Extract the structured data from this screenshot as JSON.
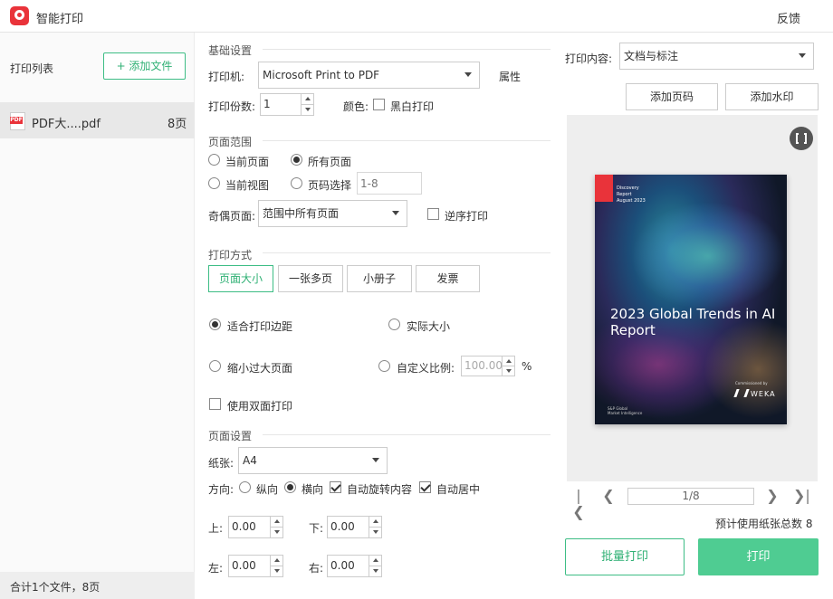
{
  "titlebar": {
    "title": "智能打印",
    "feedback": "反馈"
  },
  "sidebar": {
    "title": "打印列表",
    "add_file": "+ 添加文件",
    "files": [
      {
        "name": "PDF大....pdf",
        "pages": "8页"
      }
    ],
    "footer": "合计1个文件，8页"
  },
  "basic": {
    "section": "基础设置",
    "printer_label": "打印机:",
    "printer_value": "Microsoft Print to PDF",
    "properties": "属性",
    "copies_label": "打印份数:",
    "copies_value": "1",
    "color_label": "颜色:",
    "bw_label": "黑白打印",
    "bw_checked": false
  },
  "range": {
    "section": "页面范围",
    "current_page": "当前页面",
    "all_pages": "所有页面",
    "current_view": "当前视图",
    "page_select": "页码选择",
    "page_select_placeholder": "1-8",
    "selected": "all_pages",
    "odd_even_label": "奇偶页面:",
    "odd_even_value": "范围中所有页面",
    "reverse_label": "逆序打印",
    "reverse_checked": false
  },
  "mode": {
    "section": "打印方式",
    "tabs": [
      "页面大小",
      "一张多页",
      "小册子",
      "发票"
    ],
    "active_tab": 0,
    "fit_margin": "适合打印边距",
    "actual_size": "实际大小",
    "shrink_large": "缩小过大页面",
    "custom_scale": "自定义比例:",
    "custom_scale_value": "100.00",
    "percent": "%",
    "selected_scale": "fit_margin",
    "duplex_label": "使用双面打印",
    "duplex_checked": false
  },
  "page_setup": {
    "section": "页面设置",
    "paper_label": "纸张:",
    "paper_value": "A4",
    "orientation_label": "方向:",
    "portrait": "纵向",
    "landscape": "横向",
    "orientation_selected": "landscape",
    "auto_rotate": "自动旋转内容",
    "auto_rotate_checked": true,
    "auto_center": "自动居中",
    "auto_center_checked": true,
    "margin_top_label": "上:",
    "margin_top": "0.00",
    "margin_bottom_label": "下:",
    "margin_bottom": "0.00",
    "margin_left_label": "左:",
    "margin_left": "0.00",
    "margin_right_label": "右:",
    "margin_right": "0.00"
  },
  "right": {
    "content_label": "打印内容:",
    "content_value": "文档与标注",
    "add_page_number": "添加页码",
    "add_watermark": "添加水印",
    "page_indicator": "1/8",
    "paper_total": "预计使用纸张总数 8",
    "batch_print": "批量打印",
    "print": "打印"
  },
  "cover": {
    "tag_line1": "Discovery",
    "tag_line2": "Report",
    "tag_line3": "August 2023",
    "title": "2023 Global Trends in AI Report",
    "commissioned": "Commissioned by",
    "brand": "WEKA",
    "footer_line1": "S&P Global",
    "footer_line2": "Market Intelligence"
  },
  "colors": {
    "accent": "#3dbd85",
    "accent_text": "#2fb074",
    "print_button": "#4fcc92",
    "logo": "#e9333a"
  },
  "icons": [
    "app-logo-icon",
    "pdf-file-icon",
    "fullscreen-icon",
    "first-page-icon",
    "prev-page-icon",
    "next-page-icon",
    "last-page-icon",
    "caret-down-icon"
  ]
}
